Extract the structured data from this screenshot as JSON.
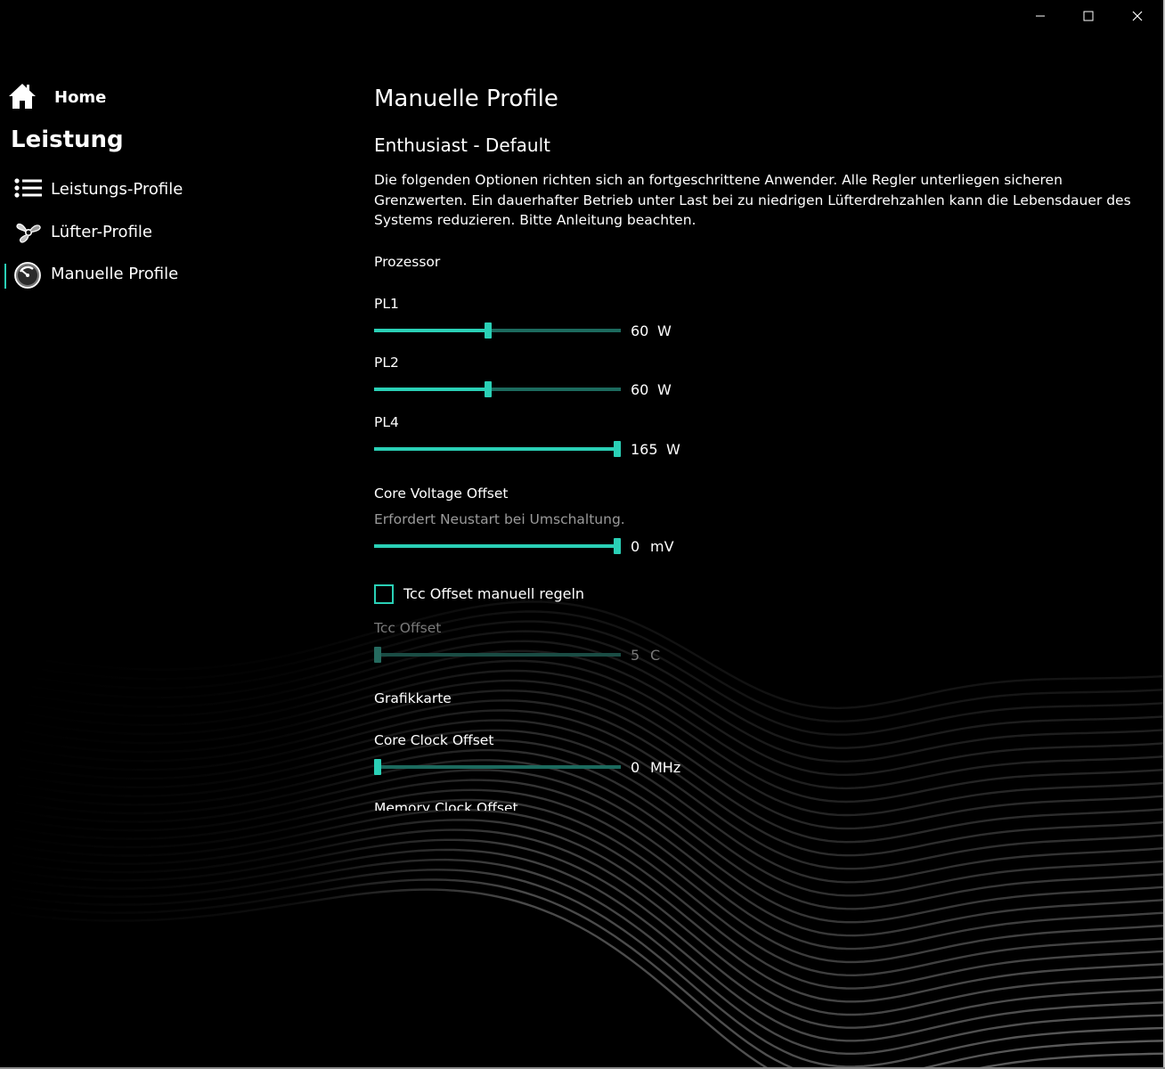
{
  "window": {
    "controls": {
      "minimize": "minimize-icon",
      "maximize": "maximize-icon",
      "close": "close-icon"
    }
  },
  "sidebar": {
    "home_label": "Home",
    "section_title": "Leistung",
    "items": [
      {
        "label": "Leistungs-Profile",
        "icon": "list-icon",
        "active": false
      },
      {
        "label": "Lüfter-Profile",
        "icon": "fan-icon",
        "active": false
      },
      {
        "label": "Manuelle Profile",
        "icon": "gauge-icon",
        "active": true
      }
    ]
  },
  "main": {
    "title": "Manuelle Profile",
    "profile_name": "Enthusiast - Default",
    "description": "Die folgenden Optionen richten sich an fortgeschrittene Anwender. Alle Regler unterliegen sicheren Grenzwerten. Ein dauerhafter Betrieb unter Last bei zu niedrigen Lüfterdrehzahlen kann die Lebensdauer des Systems reduzieren. Bitte Anleitung beachten.",
    "processor": {
      "label": "Prozessor",
      "pl1": {
        "label": "PL1",
        "value": "60",
        "unit": "W",
        "fraction": 0.46
      },
      "pl2": {
        "label": "PL2",
        "value": "60",
        "unit": "W",
        "fraction": 0.46
      },
      "pl4": {
        "label": "PL4",
        "value": "165",
        "unit": "W",
        "fraction": 1.0
      },
      "core_voltage": {
        "label": "Core Voltage Offset",
        "note": "Erfordert Neustart bei Umschaltung.",
        "value": "0",
        "unit": "mV",
        "fraction": 1.0
      },
      "tcc_checkbox": {
        "label": "Tcc Offset manuell regeln",
        "checked": false
      },
      "tcc_offset": {
        "label": "Tcc Offset",
        "value": "5",
        "unit": "C",
        "fraction": 0.0
      }
    },
    "graphics": {
      "label": "Grafikkarte",
      "core_clock": {
        "label": "Core Clock Offset",
        "value": "0",
        "unit": "MHz",
        "fraction": 0.0
      },
      "memory_clock": {
        "label": "Memory Clock Offset"
      }
    }
  },
  "colors": {
    "accent": "#2ad0b6",
    "track": "#1c6a5e",
    "background": "#000000"
  }
}
